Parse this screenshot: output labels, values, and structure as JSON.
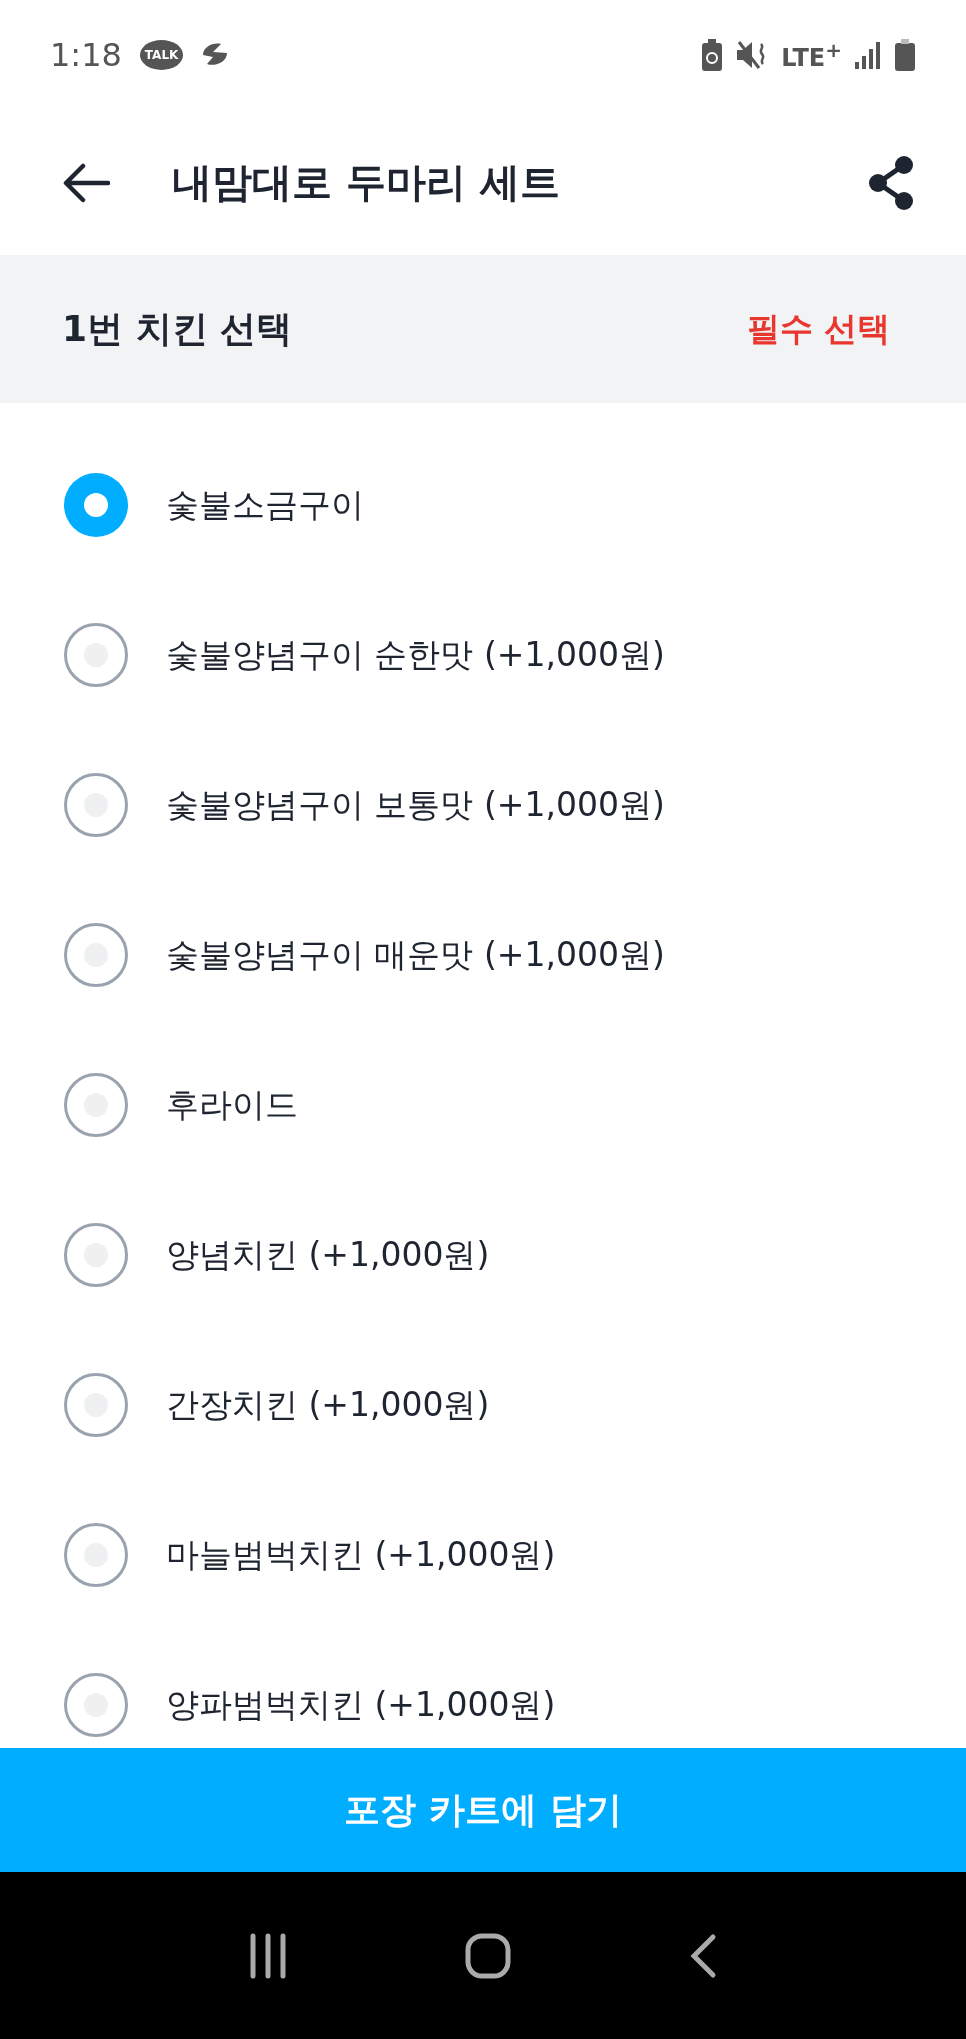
{
  "status_bar": {
    "time": "1:18",
    "talk_badge": "TALK",
    "network": "LTE$^{+}$"
  },
  "header": {
    "title": "내맘대로 두마리 세트"
  },
  "section": {
    "title": "1번 치킨 선택",
    "requirement": "필수 선택"
  },
  "options": [
    {
      "label": "숯불소금구이",
      "selected": true
    },
    {
      "label": "숯불양념구이 순한맛 (+1,000원)",
      "selected": false
    },
    {
      "label": "숯불양념구이 보통맛 (+1,000원)",
      "selected": false
    },
    {
      "label": "숯불양념구이 매운맛 (+1,000원)",
      "selected": false
    },
    {
      "label": "후라이드",
      "selected": false
    },
    {
      "label": "양념치킨 (+1,000원)",
      "selected": false
    },
    {
      "label": "간장치킨 (+1,000원)",
      "selected": false
    },
    {
      "label": "마늘범벅치킨 (+1,000원)",
      "selected": false
    },
    {
      "label": "양파범벅치킨 (+1,000원)",
      "selected": false
    }
  ],
  "cart_button": "포장 카트에 담기"
}
